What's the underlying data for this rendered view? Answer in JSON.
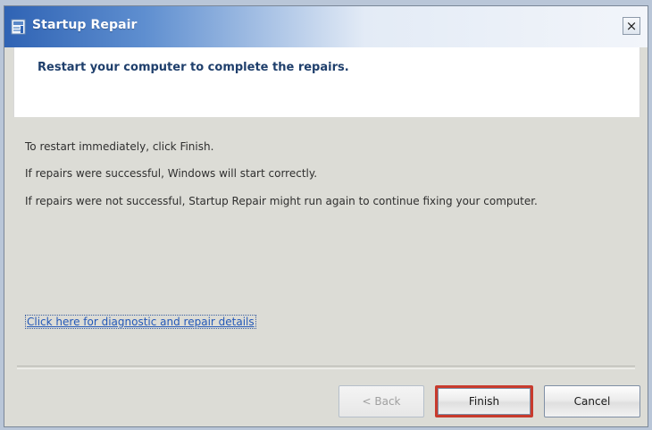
{
  "window": {
    "title": "Startup Repair",
    "close_glyph": "×"
  },
  "header": {
    "title": "Restart your computer to complete the repairs."
  },
  "content": {
    "lines": [
      "To restart immediately, click Finish.",
      "If repairs were successful, Windows will start correctly.",
      "If repairs were not successful, Startup Repair might run again to continue fixing your computer."
    ],
    "link_label": "Click here for diagnostic and repair details"
  },
  "buttons": {
    "back": "< Back",
    "finish": "Finish",
    "cancel": "Cancel"
  },
  "colors": {
    "title_bar_start": "#2f63b4",
    "header_title": "#1f3f6c",
    "link": "#2459b8",
    "finish_highlight": "#c83b2d"
  },
  "icons": {
    "app_icon": "startup-repair-icon",
    "close_icon": "close-icon"
  }
}
